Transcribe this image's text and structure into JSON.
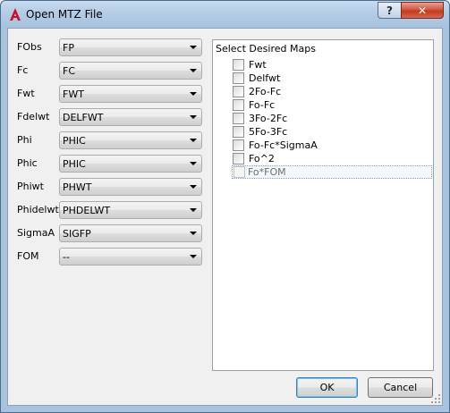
{
  "window": {
    "title": "Open MTZ File",
    "help_glyph": "?",
    "close_glyph": "✕",
    "app_icon": "autocad-a-icon",
    "accent": "#c8102e"
  },
  "fields": [
    {
      "label": "FObs",
      "value": "FP"
    },
    {
      "label": "Fc",
      "value": "FC"
    },
    {
      "label": "Fwt",
      "value": "FWT"
    },
    {
      "label": "Fdelwt",
      "value": "DELFWT"
    },
    {
      "label": "Phi",
      "value": "PHIC"
    },
    {
      "label": "Phic",
      "value": "PHIC"
    },
    {
      "label": "Phiwt",
      "value": "PHWT"
    },
    {
      "label": "Phidelwt",
      "value": "PHDELWT"
    },
    {
      "label": "SigmaA",
      "value": "SIGFP"
    },
    {
      "label": "FOM",
      "value": "--"
    }
  ],
  "maps": {
    "title": "Select Desired Maps",
    "items": [
      {
        "label": "Fwt",
        "checked": false
      },
      {
        "label": "Delfwt",
        "checked": false
      },
      {
        "label": "2Fo-Fc",
        "checked": false
      },
      {
        "label": "Fo-Fc",
        "checked": false
      },
      {
        "label": "3Fo-2Fc",
        "checked": false
      },
      {
        "label": "5Fo-3Fc",
        "checked": false
      },
      {
        "label": "Fo-Fc*SigmaA",
        "checked": false
      },
      {
        "label": "Fo^2",
        "checked": false
      },
      {
        "label": "Fo*FOM",
        "checked": false,
        "disabled": true
      }
    ]
  },
  "buttons": {
    "ok": "OK",
    "cancel": "Cancel"
  }
}
